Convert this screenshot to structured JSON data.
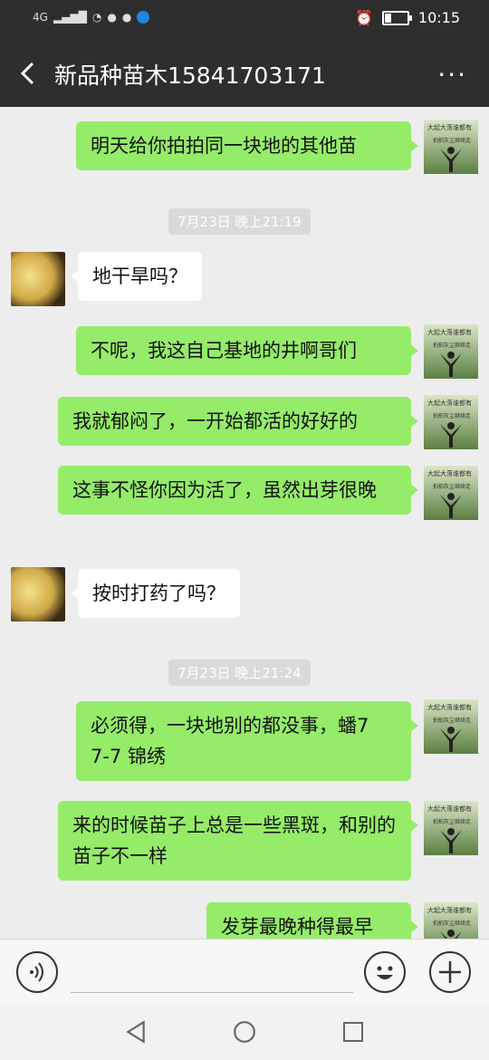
{
  "status_bar": {
    "network": "4G",
    "time": "10:15",
    "battery_level": 0.3
  },
  "header": {
    "title": "新品种苗木15841703171",
    "more_label": "···"
  },
  "messages": [
    {
      "sender": "me",
      "text": "明天给你拍拍同一块地的其他苗"
    },
    {
      "type": "timestamp",
      "text": "7月23日 晚上21:19"
    },
    {
      "sender": "them",
      "text": "地干旱吗？"
    },
    {
      "sender": "me",
      "text": "不呢，我这自己基地的井啊哥们"
    },
    {
      "sender": "me",
      "text": "我就郁闷了，一开始都活的好好的"
    },
    {
      "sender": "me",
      "text": "这事不怪你因为活了，虽然出芽很晚"
    },
    {
      "sender": "them",
      "text": "按时打药了吗？"
    },
    {
      "type": "timestamp",
      "text": "7月23日 晚上21:24"
    },
    {
      "sender": "me",
      "text": "必须得，一块地别的都没事，蟠7　7-7 锦绣"
    },
    {
      "sender": "me",
      "text": "来的时候苗子上总是一些黑斑，和别的苗子不一样"
    },
    {
      "sender": "me",
      "text": "发芽最晚种得最早"
    }
  ],
  "my_avatar": {
    "caption_line1": "大起大落谁都有",
    "caption_line2": "拍拍灰尘继续走"
  },
  "colors": {
    "header_bg": "#2e2e2e",
    "chat_bg": "#ededed",
    "my_bubble": "#95ec69",
    "their_bubble": "#ffffff"
  },
  "icons": [
    "back-arrow-icon",
    "more-dots-icon",
    "voice-icon",
    "emoji-icon",
    "plus-icon",
    "nav-back-icon",
    "nav-home-icon",
    "nav-recent-icon"
  ]
}
